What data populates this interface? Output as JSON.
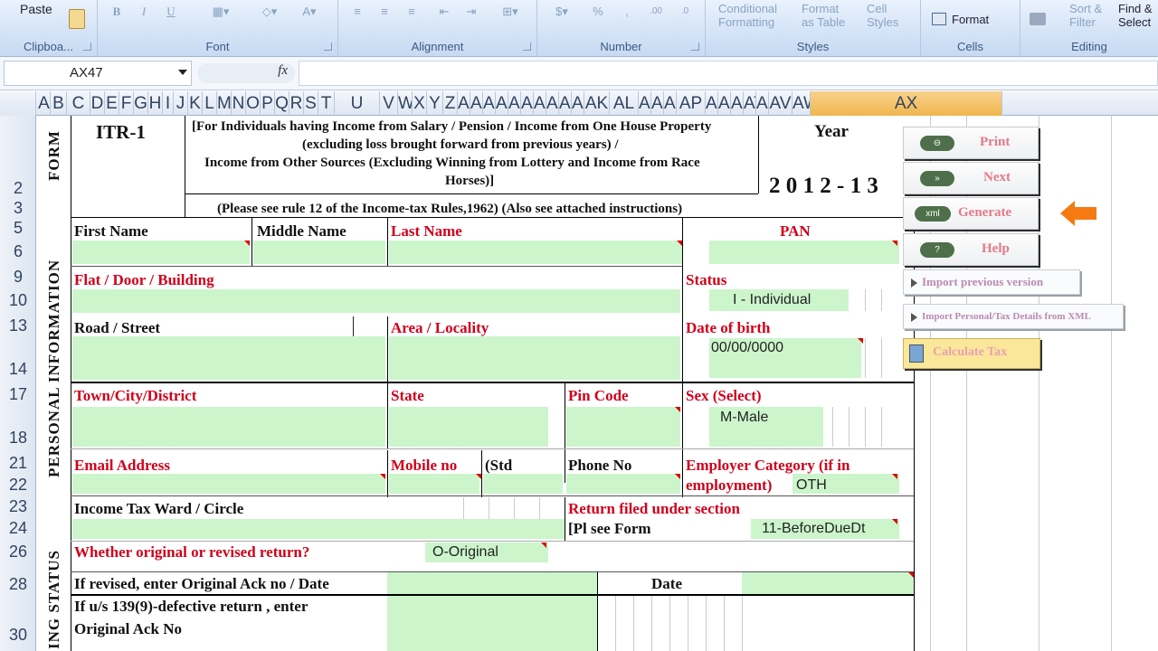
{
  "ribbon": {
    "paste": "Paste",
    "groups": {
      "clipboard": "Clipboa...",
      "font": "Font",
      "alignment": "Alignment",
      "number": "Number",
      "styles": "Styles",
      "cells": "Cells",
      "editing": "Editing"
    },
    "percent": "%",
    "conditional_formatting_1": "Conditional",
    "conditional_formatting_2": "Formatting",
    "format_as_table_1": "Format",
    "format_as_table_2": "as Table",
    "cell_styles_1": "Cell",
    "cell_styles_2": "Styles",
    "format": "Format",
    "sort_filter_1": "Sort &",
    "sort_filter_2": "Filter",
    "find_select_1": "Find &",
    "find_select_2": "Select"
  },
  "formula_bar": {
    "name_box": "AX47",
    "fx": "fx"
  },
  "columns": [
    "A",
    "B",
    "C",
    "D",
    "E",
    "F",
    "G",
    "H",
    "I",
    "J",
    "K",
    "L",
    "M",
    "N",
    "O",
    "P",
    "Q",
    "R",
    "S",
    "T",
    "U",
    "V",
    "W",
    "X",
    "Y",
    "Z",
    "AA",
    "AB",
    "AC",
    "AD",
    "AE",
    "AF",
    "AG",
    "AH",
    "AI",
    "AJ",
    "AK",
    "AL",
    "AM",
    "AN",
    "AO",
    "AP",
    "AQ",
    "AR",
    "AS",
    "AT",
    "AU",
    "AV",
    "AW",
    "AX"
  ],
  "rows": [
    "2",
    "3",
    "5",
    "6",
    "9",
    "10",
    "13",
    "14",
    "17",
    "18",
    "21",
    "22",
    "23",
    "24",
    "26",
    "28",
    "30"
  ],
  "form": {
    "form_label": "FORM",
    "itr": "ITR-1",
    "desc_1": "[For Individuals having Income from Salary / Pension / Income from One House Property",
    "desc_2": "(excluding loss brought forward from previous years) /",
    "desc_3": "Income from Other Sources (Excluding Winning from Lottery and Income from Race",
    "desc_4": "Horses)]",
    "rule_note": "(Please see rule 12 of the Income-tax Rules,1962) (Also see attached instructions)",
    "year_label": "Year",
    "year_value": "2 0 1 2 - 1 3",
    "personal_info_label": "PERSONAL INFORMATION",
    "filing_status_label": "ING STATUS",
    "first_name": "First Name",
    "middle_name": "Middle Name",
    "last_name": "Last Name",
    "pan": "PAN",
    "flat": "Flat / Door / Building",
    "status": "Status",
    "status_value": "I - Individual",
    "road": "Road / Street",
    "area": "Area / Locality",
    "dob": "Date of birth",
    "dob_value": "00/00/0000",
    "town": "Town/City/District",
    "state": "State",
    "pin": "Pin Code",
    "sex": "Sex (Select)",
    "sex_value": "M-Male",
    "email": "Email Address",
    "mobile": "Mobile no",
    "std": "(Std",
    "phone": "Phone No",
    "employer_1": "Employer Category (if in",
    "employer_2": "employment)",
    "employer_value": "OTH",
    "ward": "Income Tax Ward / Circle",
    "return_section": "Return filed under section",
    "pl_see": "[Pl see Form",
    "return_value": "11-BeforeDueDt",
    "orig_revised": "Whether original or revised return?",
    "orig_value": "O-Original",
    "revised_ack": "If revised, enter Original Ack no / Date",
    "date": "Date",
    "defective_1": "If u/s 139(9)-defective return , enter",
    "defective_2": "Original Ack No"
  },
  "side_buttons": {
    "print": "Print",
    "next": "Next",
    "generate": "Generate",
    "help": "Help",
    "import_prev": "Import previous version",
    "import_xml": "Import Personal/Tax Details from XML",
    "calc": "Calculate Tax",
    "pill_xml": "xml",
    "pill_help": "?"
  }
}
